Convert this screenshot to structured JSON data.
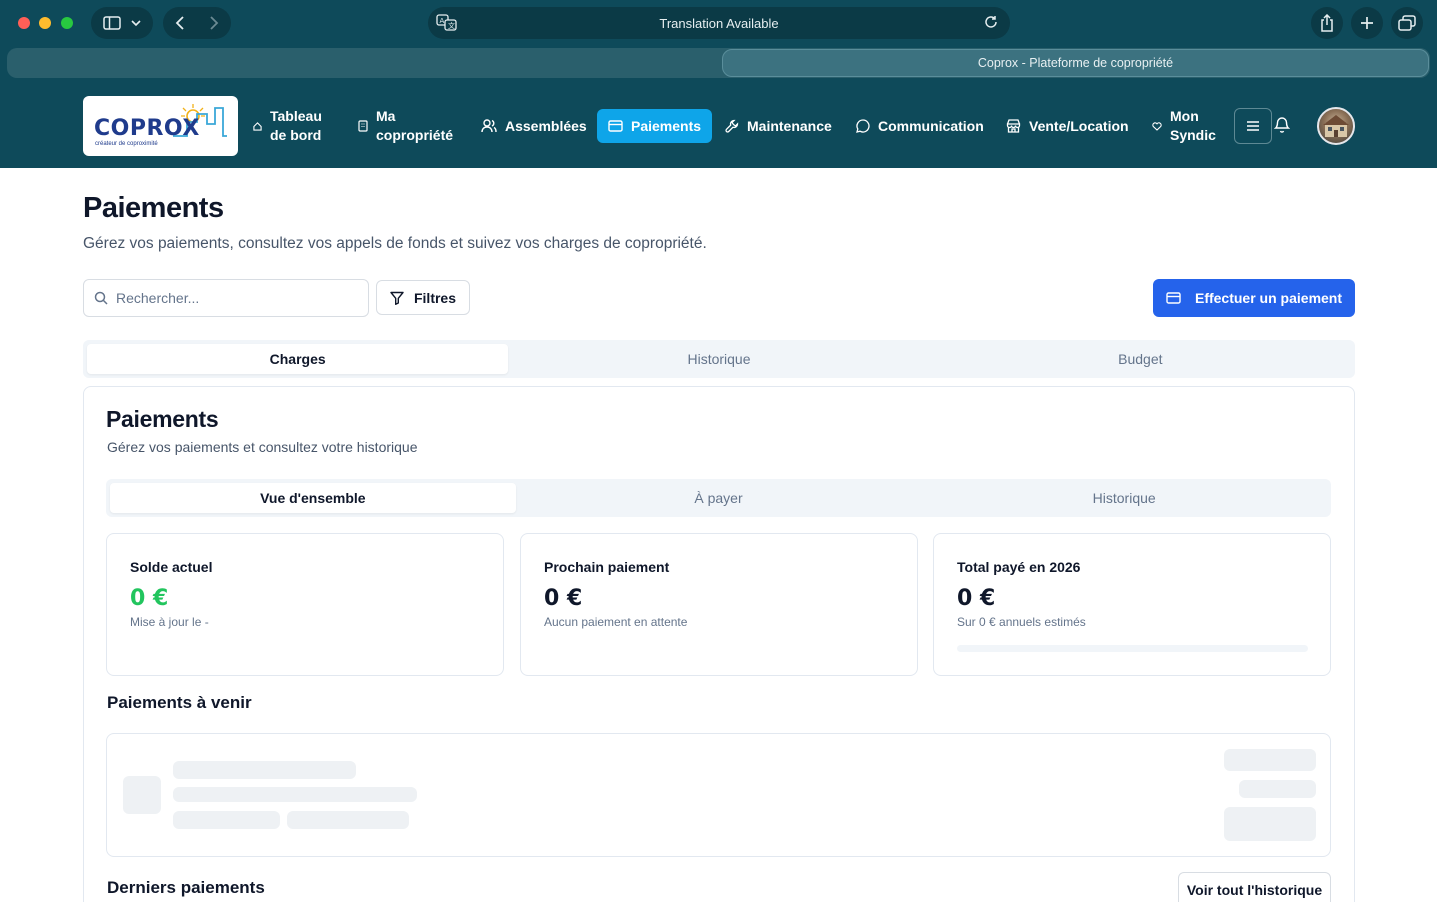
{
  "browser": {
    "url_text": "Translation Available",
    "tab_title": "Coprox - Plateforme de copropriété"
  },
  "logo": {
    "name": "COPROX",
    "tagline": "créateur de coproximité"
  },
  "nav": {
    "items": [
      {
        "label_l1": "Tableau",
        "label_l2": "de bord",
        "icon": "home-icon"
      },
      {
        "label_l1": "Ma",
        "label_l2": "copropriété",
        "icon": "building-icon"
      },
      {
        "label": "Assemblées",
        "icon": "users-icon"
      },
      {
        "label": "Paiements",
        "icon": "credit-card-icon",
        "active": true
      },
      {
        "label": "Maintenance",
        "icon": "wrench-icon"
      },
      {
        "label": "Communication",
        "icon": "message-circle-icon"
      },
      {
        "label": "Vente/Location",
        "icon": "store-icon"
      },
      {
        "label_l1": "Mon",
        "label_l2": "Syndic",
        "icon": "heart-icon"
      }
    ]
  },
  "page": {
    "title": "Paiements",
    "subtitle": "Gérez vos paiements, consultez vos appels de fonds et suivez vos charges de copropriété.",
    "search_placeholder": "Rechercher...",
    "filters_label": "Filtres",
    "pay_button": "Effectuer un paiement",
    "tabs": [
      "Charges",
      "Historique",
      "Budget"
    ],
    "active_tab": "Charges"
  },
  "card": {
    "title": "Paiements",
    "subtitle": "Gérez vos paiements et consultez votre historique",
    "tabs": [
      "Vue d'ensemble",
      "À payer",
      "Historique"
    ],
    "active_tab": "Vue d'ensemble",
    "stats": [
      {
        "label": "Solde actuel",
        "value": "0 €",
        "note": "Mise à jour le -",
        "value_color": "#22c55e"
      },
      {
        "label": "Prochain paiement",
        "value": "0 €",
        "note": "Aucun paiement en attente"
      },
      {
        "label": "Total payé en 2026",
        "value": "0 €",
        "note": "Sur 0 € annuels estimés",
        "progress": 0
      }
    ],
    "upcoming_title": "Paiements à venir",
    "recent_title": "Derniers paiements",
    "history_button": "Voir tout l'historique"
  },
  "colors": {
    "header_bg": "#0e4a5a",
    "accent_active_nav": "#0ea5e9",
    "primary_button": "#2563eb",
    "positive": "#22c55e"
  }
}
